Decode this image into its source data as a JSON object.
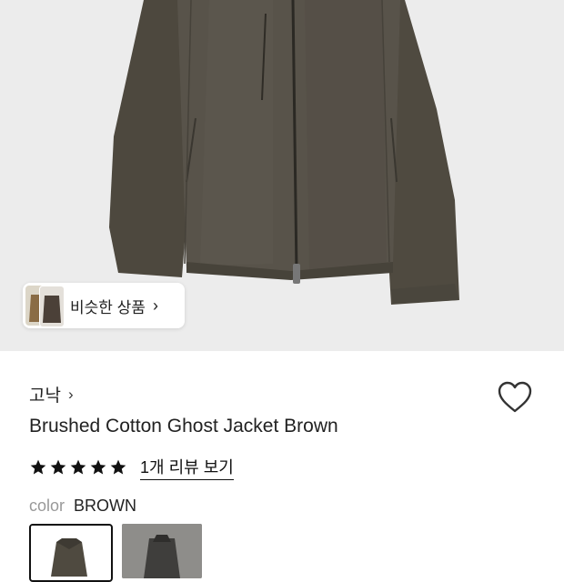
{
  "similar": {
    "label": "비슷한 상품",
    "chevron": "›"
  },
  "product": {
    "brand": "고낙",
    "brand_chevron": "›",
    "title": "Brushed Cotton Ghost Jacket Brown",
    "rating": 5,
    "review_link": "1개 리뷰 보기",
    "color_label": "color",
    "color_value": "BROWN"
  },
  "colors": {
    "jacket": "#4e4a40",
    "hero_bg": "#ececec",
    "accent": "#111111"
  },
  "icons": {
    "wishlist": "heart-icon",
    "star": "star-icon"
  }
}
